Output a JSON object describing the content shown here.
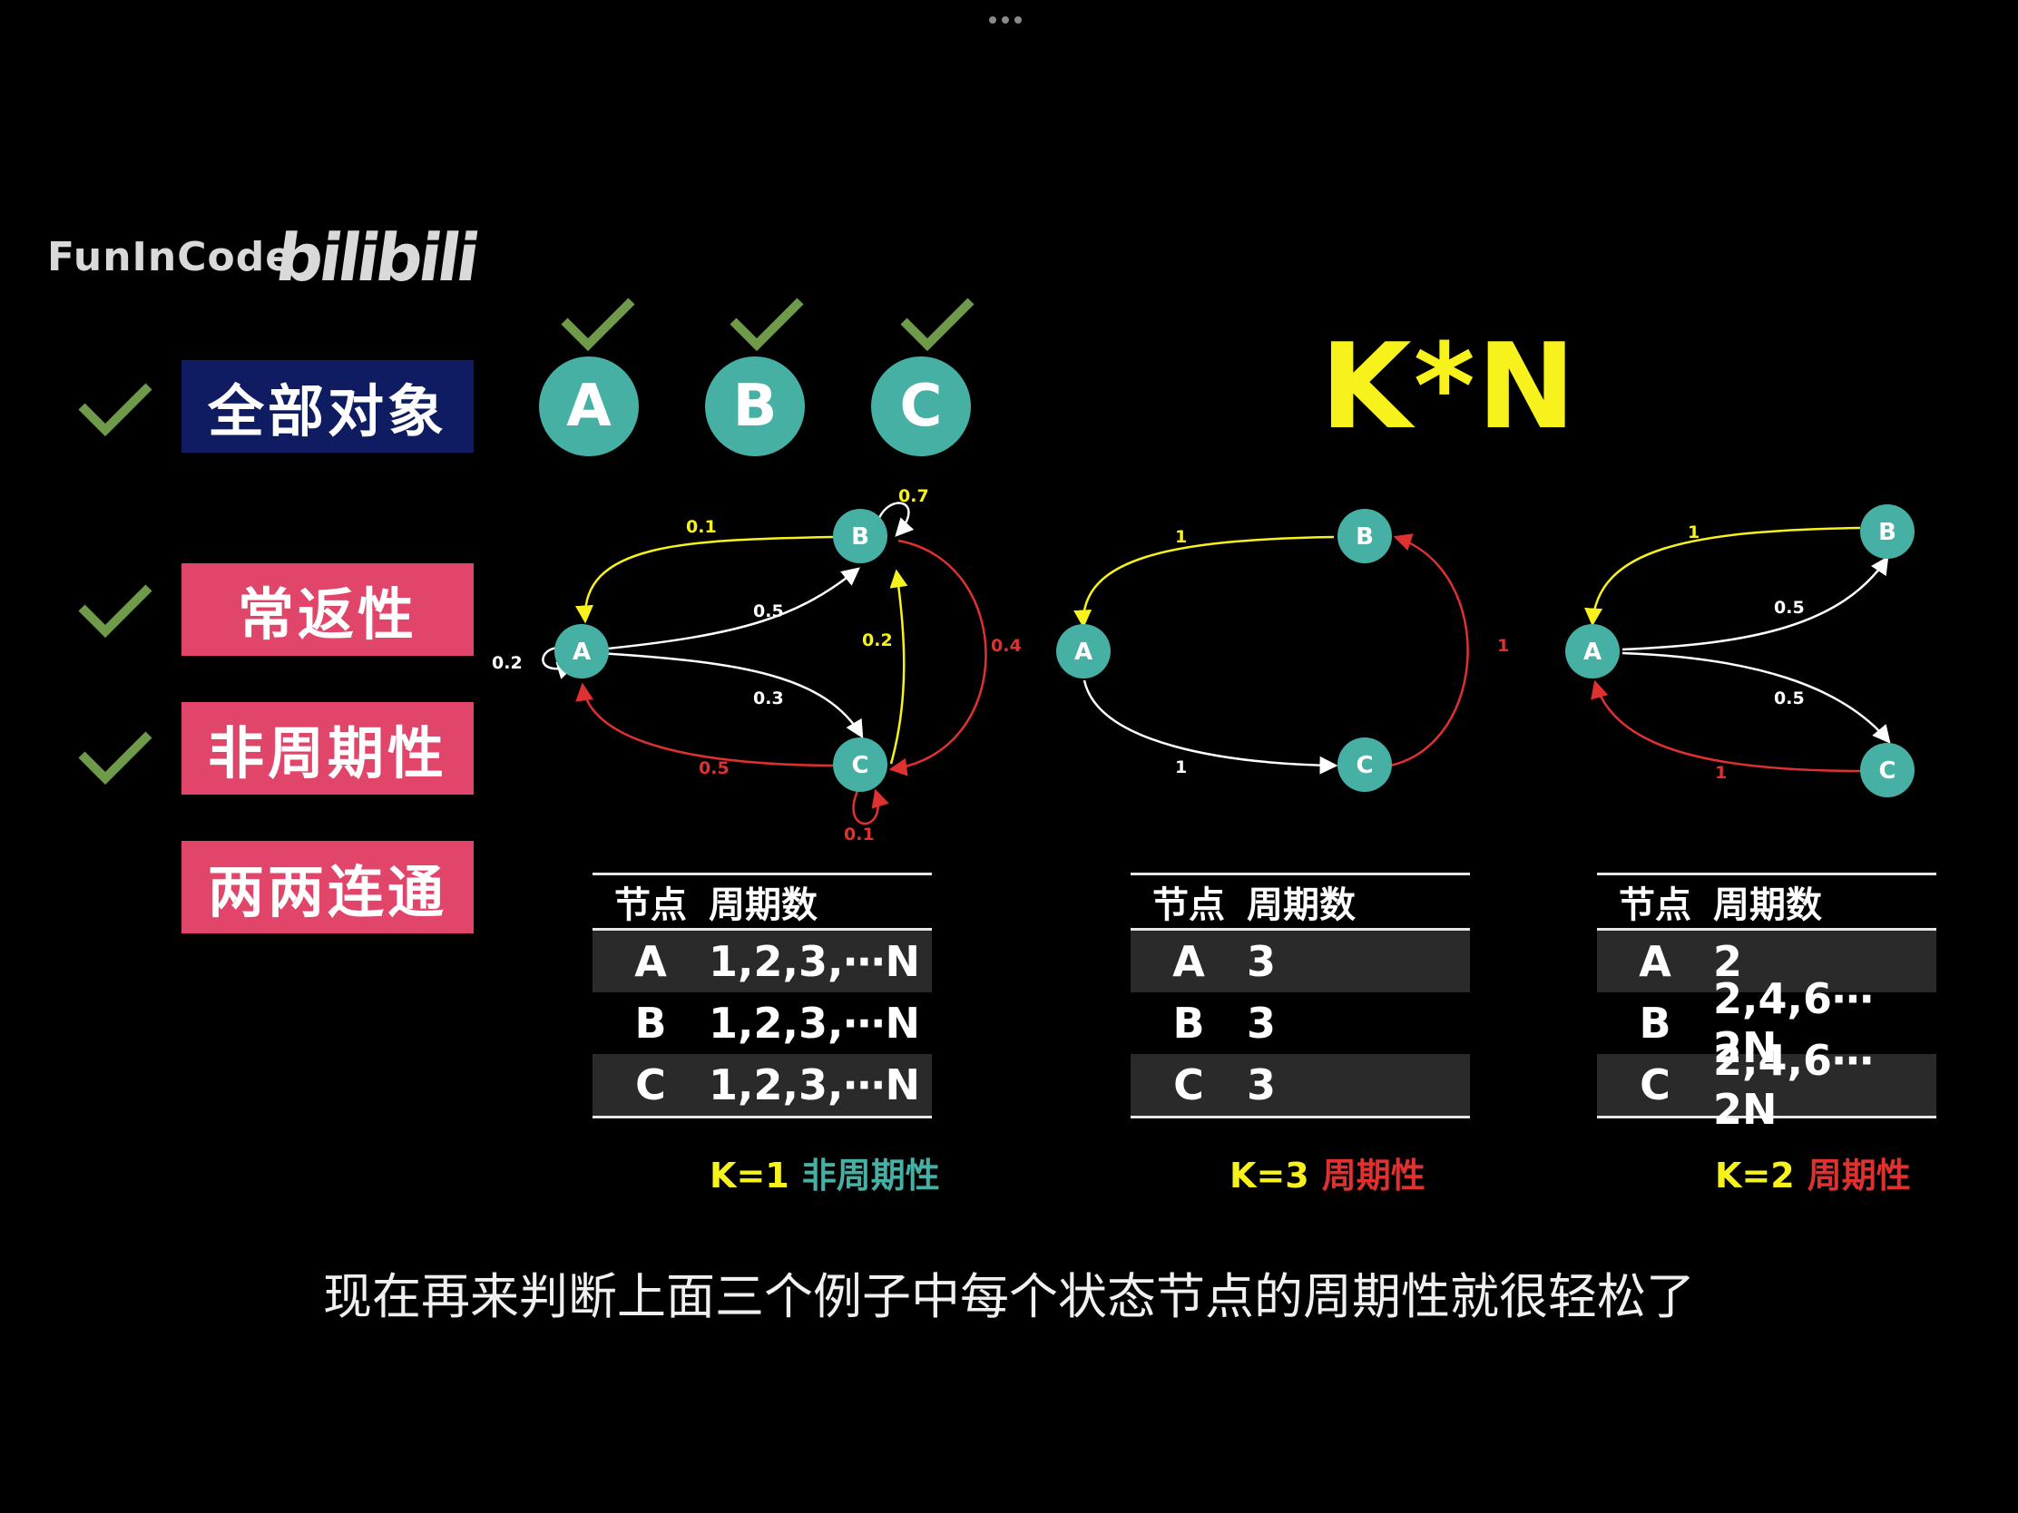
{
  "window": {
    "menu_icon": "more-dots-icon"
  },
  "brand": {
    "name": "FunInCode",
    "logo": "bilibili"
  },
  "tags": [
    "全部对象",
    "常返性",
    "非周期性",
    "两两连通"
  ],
  "colors": {
    "teal": "#45b0a3",
    "yellow": "#f7f21c",
    "red": "#e03131",
    "navy": "#0f1c62",
    "pink": "#e1456a",
    "check": "#6f9a4a"
  },
  "top_nodes": [
    "A",
    "B",
    "C"
  ],
  "formula": "K*N",
  "graphs": [
    {
      "nodes": [
        "A",
        "B",
        "C"
      ],
      "edges": [
        "0.1",
        "0.7",
        "0.5",
        "0.2",
        "0.2",
        "0.4",
        "0.3",
        "0.5",
        "0.1"
      ]
    },
    {
      "nodes": [
        "A",
        "B",
        "C"
      ],
      "edges": [
        "1",
        "1",
        "1"
      ]
    },
    {
      "nodes": [
        "A",
        "B",
        "C"
      ],
      "edges": [
        "1",
        "0.5",
        "0.5",
        "1"
      ]
    }
  ],
  "tables": [
    {
      "headers": [
        "节点",
        "周期数"
      ],
      "rows": [
        [
          "A",
          "1,2,3,⋯N"
        ],
        [
          "B",
          "1,2,3,⋯N"
        ],
        [
          "C",
          "1,2,3,⋯N"
        ]
      ],
      "caption_k": "K=1",
      "caption_p": "非周期性",
      "caption_color": "#45b0a3"
    },
    {
      "headers": [
        "节点",
        "周期数"
      ],
      "rows": [
        [
          "A",
          "3"
        ],
        [
          "B",
          "3"
        ],
        [
          "C",
          "3"
        ]
      ],
      "caption_k": "K=3",
      "caption_p": "周期性",
      "caption_color": "#e03131"
    },
    {
      "headers": [
        "节点",
        "周期数"
      ],
      "rows": [
        [
          "A",
          "2"
        ],
        [
          "B",
          "2,4,6⋯2N"
        ],
        [
          "C",
          "2,4,6⋯2N"
        ]
      ],
      "caption_k": "K=2",
      "caption_p": "周期性",
      "caption_color": "#e03131"
    }
  ],
  "subtitle": "现在再来判断上面三个例子中每个状态节点的周期性就很轻松了"
}
